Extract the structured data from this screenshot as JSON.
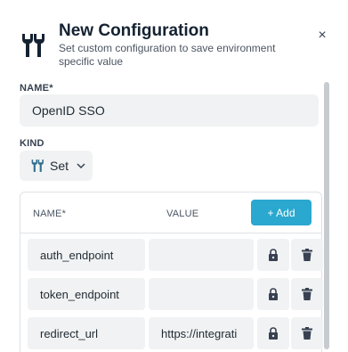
{
  "header": {
    "title": "New Configuration",
    "subtitle": "Set custom configuration to save environment specific value",
    "icon": "tools-icon"
  },
  "close": {
    "glyph": "×"
  },
  "form": {
    "name_label": "NAME*",
    "name_value": "OpenID SSO",
    "kind_label": "KIND",
    "kind_value": "Set"
  },
  "table": {
    "col_name": "NAME*",
    "col_value": "VALUE",
    "add_label": "+ Add",
    "rows": [
      {
        "key": "auth_endpoint",
        "value": ""
      },
      {
        "key": "token_endpoint",
        "value": ""
      },
      {
        "key": "redirect_url",
        "value": "https://integrati"
      }
    ]
  },
  "colors": {
    "accent": "#2aa8cf",
    "title": "#152232",
    "field_bg": "#f1f2f3"
  }
}
